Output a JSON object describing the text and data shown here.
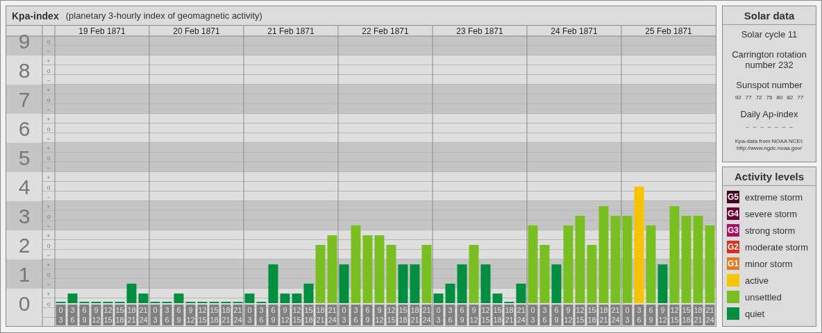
{
  "kpa_chart": {
    "title": "Kpa-index",
    "subtitle": "(planetary 3-hourly index of geomagnetic activity)",
    "days": [
      {
        "date": "19 Feb 1871"
      },
      {
        "date": "20 Feb 1871"
      },
      {
        "date": "21 Feb 1871"
      },
      {
        "date": "22 Feb 1871"
      },
      {
        "date": "23 Feb 1871"
      },
      {
        "date": "24 Feb 1871"
      },
      {
        "date": "25 Feb 1871"
      }
    ],
    "scale_rows": [
      {
        "level": "9",
        "shaded": true,
        "signs": [
          "o",
          "−"
        ]
      },
      {
        "level": "8",
        "shaded": false,
        "signs": [
          "+",
          "o",
          "−"
        ]
      },
      {
        "level": "7",
        "shaded": true,
        "signs": [
          "+",
          "o",
          "−"
        ]
      },
      {
        "level": "6",
        "shaded": false,
        "signs": [
          "+",
          "o",
          "−"
        ]
      },
      {
        "level": "5",
        "shaded": true,
        "signs": [
          "+",
          "o",
          "−"
        ]
      },
      {
        "level": "4",
        "shaded": false,
        "signs": [
          "+",
          "o",
          "−"
        ]
      },
      {
        "level": "3",
        "shaded": true,
        "signs": [
          "+",
          "o",
          "−"
        ]
      },
      {
        "level": "2",
        "shaded": false,
        "signs": [
          "+",
          "o",
          "−"
        ]
      },
      {
        "level": "1",
        "shaded": true,
        "signs": [
          "+",
          "o",
          "−"
        ]
      },
      {
        "level": "0",
        "shaded": false,
        "signs": [
          "+",
          "o"
        ]
      }
    ],
    "chart_data": {
      "type": "bar",
      "grid": true,
      "ylim": [
        0,
        9
      ],
      "yticks": [
        0,
        1,
        2,
        3,
        4,
        5,
        6,
        7,
        8,
        9
      ],
      "categories": [
        "0\n3",
        "3\n6",
        "6\n9",
        "9\n12",
        "12\n15",
        "15\n18",
        "18\n21",
        "21\n24",
        "0\n3",
        "3\n6",
        "6\n9",
        "9\n12",
        "12\n15",
        "15\n18",
        "18\n21",
        "21\n24",
        "0\n3",
        "3\n6",
        "6\n9",
        "9\n12",
        "12\n15",
        "15\n18",
        "18\n21",
        "21\n24",
        "0\n3",
        "3\n6",
        "6\n9",
        "9\n12",
        "12\n15",
        "15\n18",
        "18\n21",
        "21\n24",
        "0\n3",
        "3\n6",
        "6\n9",
        "9\n12",
        "12\n15",
        "15\n18",
        "18\n21",
        "21\n24",
        "0\n3",
        "3\n6",
        "6\n9",
        "9\n12",
        "12\n15",
        "15\n18",
        "18\n21",
        "21\n24",
        "0\n3",
        "3\n6",
        "6\n9",
        "9\n12",
        "12\n15",
        "15\n18",
        "18\n21",
        "21\n24"
      ],
      "series": [
        {
          "name": "quiet",
          "color": "#008f3e",
          "values": [
            0,
            0.33,
            0,
            0,
            0,
            0,
            0.67,
            0.33,
            0,
            0,
            0.33,
            0,
            0,
            0,
            0,
            0,
            0.33,
            0,
            1.33,
            0.33,
            0.33,
            0.67,
            null,
            null,
            1.33,
            null,
            null,
            null,
            null,
            1.33,
            1.33,
            null,
            0.33,
            0.67,
            1.33,
            null,
            1.33,
            0.33,
            0,
            0.67,
            null,
            null,
            1.33,
            null,
            null,
            null,
            null,
            null,
            null,
            null,
            null,
            1.33,
            null,
            null,
            null,
            null
          ]
        },
        {
          "name": "unsettled",
          "color": "#7abf22",
          "values": [
            null,
            null,
            null,
            null,
            null,
            null,
            null,
            null,
            null,
            null,
            null,
            null,
            null,
            null,
            null,
            null,
            null,
            null,
            null,
            null,
            null,
            null,
            2,
            2.33,
            null,
            2.67,
            2.33,
            2.33,
            2,
            null,
            null,
            2,
            null,
            null,
            null,
            2,
            null,
            null,
            null,
            null,
            2.67,
            2,
            null,
            2.67,
            3,
            2,
            3.33,
            3,
            3,
            null,
            2.67,
            null,
            3.33,
            3,
            3,
            2.67
          ]
        },
        {
          "name": "active",
          "color": "#f8c300",
          "values": [
            null,
            null,
            null,
            null,
            null,
            null,
            null,
            null,
            null,
            null,
            null,
            null,
            null,
            null,
            null,
            null,
            null,
            null,
            null,
            null,
            null,
            null,
            null,
            null,
            null,
            null,
            null,
            null,
            null,
            null,
            null,
            null,
            null,
            null,
            null,
            null,
            null,
            null,
            null,
            null,
            null,
            null,
            null,
            null,
            null,
            null,
            null,
            null,
            null,
            4,
            null,
            null,
            null,
            null,
            null,
            null
          ]
        }
      ]
    }
  },
  "solar_data": {
    "title": "Solar data",
    "solar_cycle": "Solar cycle 11",
    "carrington_rotation": "Carrington rotation number 232",
    "sunspot_label": "Sunspot number",
    "sunspot_values": [
      "92",
      "77",
      "72",
      "75",
      "80",
      "82",
      "77"
    ],
    "ap_label": "Daily Ap-index",
    "ap_values": [
      "–",
      "–",
      "–",
      "–",
      "–",
      "–",
      "–"
    ],
    "source_note": "Kpa-data from NOAA NCEI:",
    "source_url": "http://www.ngdc.noaa.gov/"
  },
  "activity_levels": {
    "title": "Activity levels",
    "items": [
      {
        "badge": "G5",
        "label": "extreme storm",
        "color": "#4b0022"
      },
      {
        "badge": "G4",
        "label": "severe storm",
        "color": "#6a0036"
      },
      {
        "badge": "G3",
        "label": "strong storm",
        "color": "#ae0e60"
      },
      {
        "badge": "G2",
        "label": "moderate storm",
        "color": "#d7301c"
      },
      {
        "badge": "G1",
        "label": "minor storm",
        "color": "#e3781c"
      }
    ]
  }
}
